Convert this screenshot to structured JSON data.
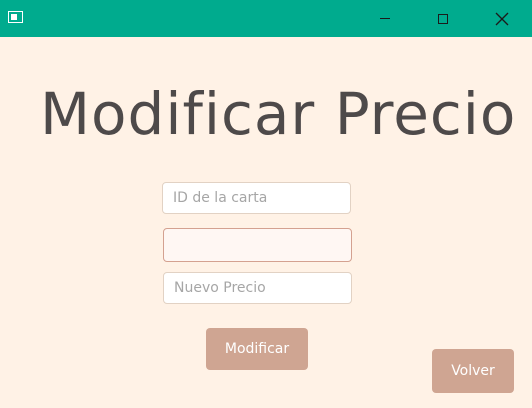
{
  "window": {
    "icons": {
      "app": "window-app-icon",
      "minimize": "minimize-icon",
      "maximize": "maximize-icon",
      "close": "close-icon"
    },
    "titlebar_color": "#00ab8e"
  },
  "page": {
    "title": "Modificar Precio",
    "background_color": "#fff2e6"
  },
  "form": {
    "card_id": {
      "placeholder": "ID de la carta",
      "value": ""
    },
    "current_price": {
      "placeholder": "",
      "value": ""
    },
    "new_price": {
      "placeholder": "Nuevo Precio",
      "value": ""
    }
  },
  "buttons": {
    "modify_label": "Modificar",
    "back_label": "Volver",
    "accent_color": "#cfa592"
  }
}
